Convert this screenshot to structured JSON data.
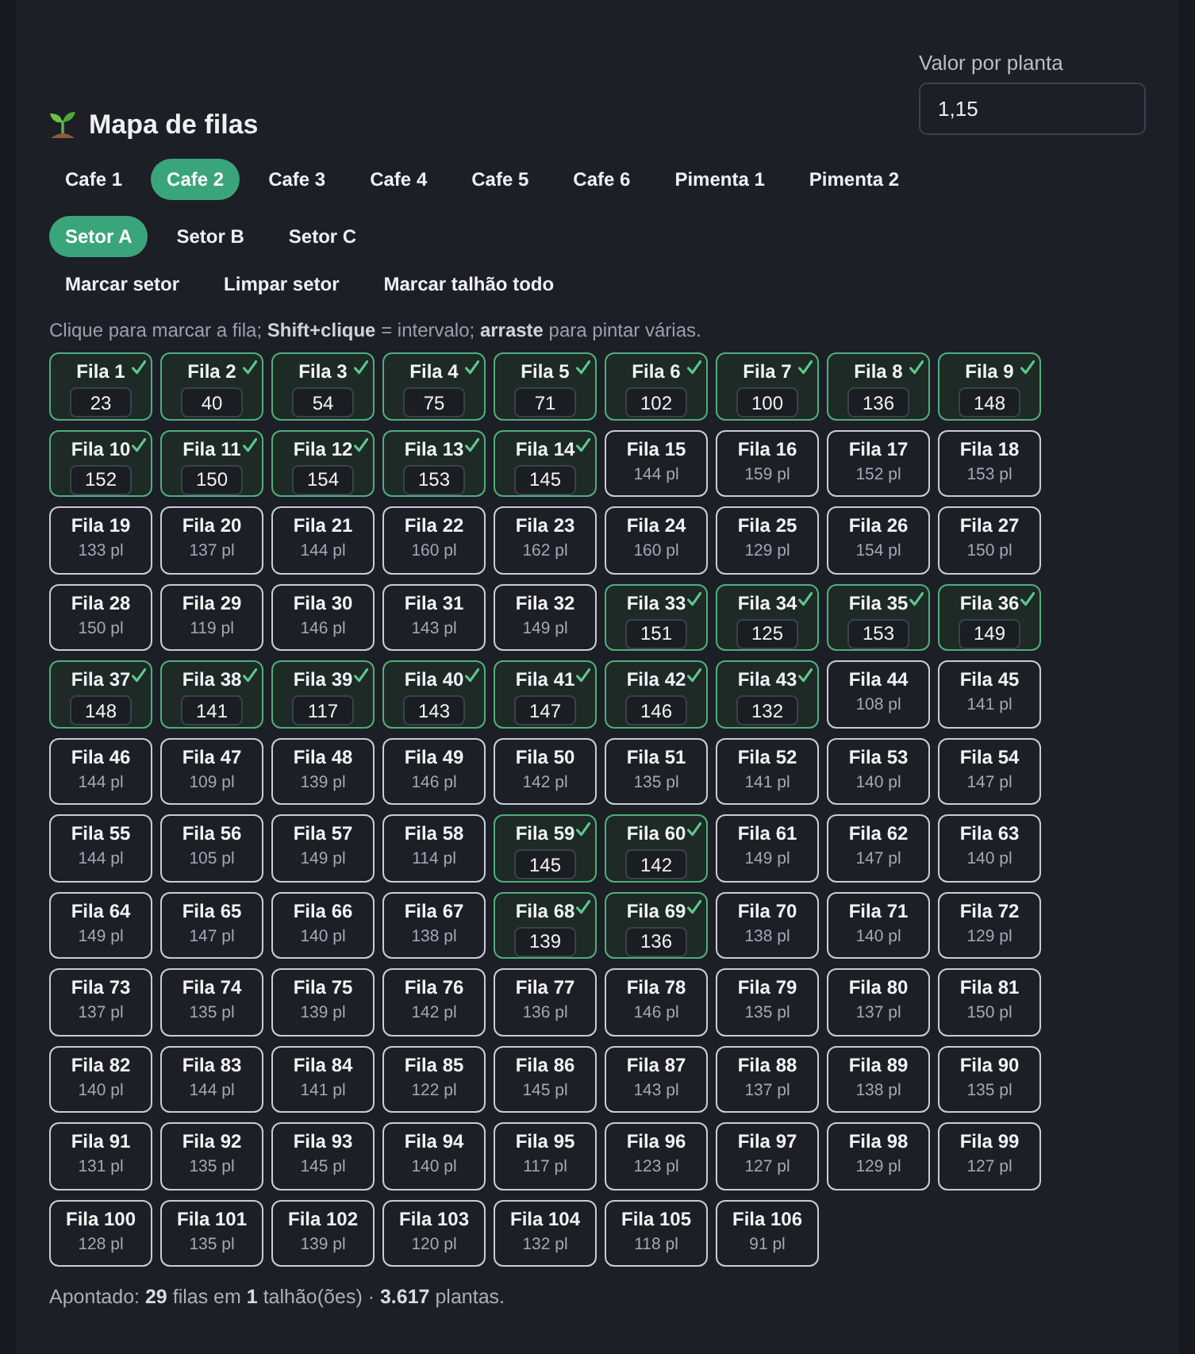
{
  "header": {
    "title": "Mapa de filas",
    "value_field": {
      "label": "Valor por planta",
      "value": "1,15"
    }
  },
  "plot_tabs": [
    {
      "label": "Cafe 1",
      "selected": false
    },
    {
      "label": "Cafe 2",
      "selected": true
    },
    {
      "label": "Cafe 3",
      "selected": false
    },
    {
      "label": "Cafe 4",
      "selected": false
    },
    {
      "label": "Cafe 5",
      "selected": false
    },
    {
      "label": "Cafe 6",
      "selected": false
    },
    {
      "label": "Pimenta 1",
      "selected": false
    },
    {
      "label": "Pimenta 2",
      "selected": false
    }
  ],
  "sector_tabs": [
    {
      "label": "Setor A",
      "selected": true
    },
    {
      "label": "Setor B",
      "selected": false
    },
    {
      "label": "Setor C",
      "selected": false
    }
  ],
  "actions": [
    "Marcar setor",
    "Limpar setor",
    "Marcar talhão todo"
  ],
  "hint": "Clique para marcar a fila; **Shift+clique** = intervalo; **arraste** para pintar várias.",
  "rows": [
    {
      "label": "Fila 1",
      "checked": true,
      "value": "23"
    },
    {
      "label": "Fila 2",
      "checked": true,
      "value": "40"
    },
    {
      "label": "Fila 3",
      "checked": true,
      "value": "54"
    },
    {
      "label": "Fila 4",
      "checked": true,
      "value": "75"
    },
    {
      "label": "Fila 5",
      "checked": true,
      "value": "71"
    },
    {
      "label": "Fila 6",
      "checked": true,
      "value": "102"
    },
    {
      "label": "Fila 7",
      "checked": true,
      "value": "100"
    },
    {
      "label": "Fila 8",
      "checked": true,
      "value": "136"
    },
    {
      "label": "Fila 9",
      "checked": true,
      "value": "148"
    },
    {
      "label": "Fila 10",
      "checked": true,
      "value": "152"
    },
    {
      "label": "Fila 11",
      "checked": true,
      "value": "150"
    },
    {
      "label": "Fila 12",
      "checked": true,
      "value": "154"
    },
    {
      "label": "Fila 13",
      "checked": true,
      "value": "153"
    },
    {
      "label": "Fila 14",
      "checked": true,
      "value": "145"
    },
    {
      "label": "Fila 15",
      "checked": false,
      "plants": "144 pl"
    },
    {
      "label": "Fila 16",
      "checked": false,
      "plants": "159 pl"
    },
    {
      "label": "Fila 17",
      "checked": false,
      "plants": "152 pl"
    },
    {
      "label": "Fila 18",
      "checked": false,
      "plants": "153 pl"
    },
    {
      "label": "Fila 19",
      "checked": false,
      "plants": "133 pl"
    },
    {
      "label": "Fila 20",
      "checked": false,
      "plants": "137 pl"
    },
    {
      "label": "Fila 21",
      "checked": false,
      "plants": "144 pl"
    },
    {
      "label": "Fila 22",
      "checked": false,
      "plants": "160 pl"
    },
    {
      "label": "Fila 23",
      "checked": false,
      "plants": "162 pl"
    },
    {
      "label": "Fila 24",
      "checked": false,
      "plants": "160 pl"
    },
    {
      "label": "Fila 25",
      "checked": false,
      "plants": "129 pl"
    },
    {
      "label": "Fila 26",
      "checked": false,
      "plants": "154 pl"
    },
    {
      "label": "Fila 27",
      "checked": false,
      "plants": "150 pl"
    },
    {
      "label": "Fila 28",
      "checked": false,
      "plants": "150 pl"
    },
    {
      "label": "Fila 29",
      "checked": false,
      "plants": "119 pl"
    },
    {
      "label": "Fila 30",
      "checked": false,
      "plants": "146 pl"
    },
    {
      "label": "Fila 31",
      "checked": false,
      "plants": "143 pl"
    },
    {
      "label": "Fila 32",
      "checked": false,
      "plants": "149 pl"
    },
    {
      "label": "Fila 33",
      "checked": true,
      "value": "151"
    },
    {
      "label": "Fila 34",
      "checked": true,
      "value": "125"
    },
    {
      "label": "Fila 35",
      "checked": true,
      "value": "153"
    },
    {
      "label": "Fila 36",
      "checked": true,
      "value": "149"
    },
    {
      "label": "Fila 37",
      "checked": true,
      "value": "148"
    },
    {
      "label": "Fila 38",
      "checked": true,
      "value": "141"
    },
    {
      "label": "Fila 39",
      "checked": true,
      "value": "117"
    },
    {
      "label": "Fila 40",
      "checked": true,
      "value": "143"
    },
    {
      "label": "Fila 41",
      "checked": true,
      "value": "147"
    },
    {
      "label": "Fila 42",
      "checked": true,
      "value": "146"
    },
    {
      "label": "Fila 43",
      "checked": true,
      "value": "132"
    },
    {
      "label": "Fila 44",
      "checked": false,
      "plants": "108 pl"
    },
    {
      "label": "Fila 45",
      "checked": false,
      "plants": "141 pl"
    },
    {
      "label": "Fila 46",
      "checked": false,
      "plants": "144 pl"
    },
    {
      "label": "Fila 47",
      "checked": false,
      "plants": "109 pl"
    },
    {
      "label": "Fila 48",
      "checked": false,
      "plants": "139 pl"
    },
    {
      "label": "Fila 49",
      "checked": false,
      "plants": "146 pl"
    },
    {
      "label": "Fila 50",
      "checked": false,
      "plants": "142 pl"
    },
    {
      "label": "Fila 51",
      "checked": false,
      "plants": "135 pl"
    },
    {
      "label": "Fila 52",
      "checked": false,
      "plants": "141 pl"
    },
    {
      "label": "Fila 53",
      "checked": false,
      "plants": "140 pl"
    },
    {
      "label": "Fila 54",
      "checked": false,
      "plants": "147 pl"
    },
    {
      "label": "Fila 55",
      "checked": false,
      "plants": "144 pl"
    },
    {
      "label": "Fila 56",
      "checked": false,
      "plants": "105 pl"
    },
    {
      "label": "Fila 57",
      "checked": false,
      "plants": "149 pl"
    },
    {
      "label": "Fila 58",
      "checked": false,
      "plants": "114 pl"
    },
    {
      "label": "Fila 59",
      "checked": true,
      "value": "145"
    },
    {
      "label": "Fila 60",
      "checked": true,
      "value": "142"
    },
    {
      "label": "Fila 61",
      "checked": false,
      "plants": "149 pl"
    },
    {
      "label": "Fila 62",
      "checked": false,
      "plants": "147 pl"
    },
    {
      "label": "Fila 63",
      "checked": false,
      "plants": "140 pl"
    },
    {
      "label": "Fila 64",
      "checked": false,
      "plants": "149 pl"
    },
    {
      "label": "Fila 65",
      "checked": false,
      "plants": "147 pl"
    },
    {
      "label": "Fila 66",
      "checked": false,
      "plants": "140 pl"
    },
    {
      "label": "Fila 67",
      "checked": false,
      "plants": "138 pl"
    },
    {
      "label": "Fila 68",
      "checked": true,
      "value": "139"
    },
    {
      "label": "Fila 69",
      "checked": true,
      "value": "136"
    },
    {
      "label": "Fila 70",
      "checked": false,
      "plants": "138 pl"
    },
    {
      "label": "Fila 71",
      "checked": false,
      "plants": "140 pl"
    },
    {
      "label": "Fila 72",
      "checked": false,
      "plants": "129 pl"
    },
    {
      "label": "Fila 73",
      "checked": false,
      "plants": "137 pl"
    },
    {
      "label": "Fila 74",
      "checked": false,
      "plants": "135 pl"
    },
    {
      "label": "Fila 75",
      "checked": false,
      "plants": "139 pl"
    },
    {
      "label": "Fila 76",
      "checked": false,
      "plants": "142 pl"
    },
    {
      "label": "Fila 77",
      "checked": false,
      "plants": "136 pl"
    },
    {
      "label": "Fila 78",
      "checked": false,
      "plants": "146 pl"
    },
    {
      "label": "Fila 79",
      "checked": false,
      "plants": "135 pl"
    },
    {
      "label": "Fila 80",
      "checked": false,
      "plants": "137 pl"
    },
    {
      "label": "Fila 81",
      "checked": false,
      "plants": "150 pl"
    },
    {
      "label": "Fila 82",
      "checked": false,
      "plants": "140 pl"
    },
    {
      "label": "Fila 83",
      "checked": false,
      "plants": "144 pl"
    },
    {
      "label": "Fila 84",
      "checked": false,
      "plants": "141 pl"
    },
    {
      "label": "Fila 85",
      "checked": false,
      "plants": "122 pl"
    },
    {
      "label": "Fila 86",
      "checked": false,
      "plants": "145 pl"
    },
    {
      "label": "Fila 87",
      "checked": false,
      "plants": "143 pl"
    },
    {
      "label": "Fila 88",
      "checked": false,
      "plants": "137 pl"
    },
    {
      "label": "Fila 89",
      "checked": false,
      "plants": "138 pl"
    },
    {
      "label": "Fila 90",
      "checked": false,
      "plants": "135 pl"
    },
    {
      "label": "Fila 91",
      "checked": false,
      "plants": "131 pl"
    },
    {
      "label": "Fila 92",
      "checked": false,
      "plants": "135 pl"
    },
    {
      "label": "Fila 93",
      "checked": false,
      "plants": "145 pl"
    },
    {
      "label": "Fila 94",
      "checked": false,
      "plants": "140 pl"
    },
    {
      "label": "Fila 95",
      "checked": false,
      "plants": "117 pl"
    },
    {
      "label": "Fila 96",
      "checked": false,
      "plants": "123 pl"
    },
    {
      "label": "Fila 97",
      "checked": false,
      "plants": "127 pl"
    },
    {
      "label": "Fila 98",
      "checked": false,
      "plants": "129 pl"
    },
    {
      "label": "Fila 99",
      "checked": false,
      "plants": "127 pl"
    },
    {
      "label": "Fila 100",
      "checked": false,
      "plants": "128 pl"
    },
    {
      "label": "Fila 101",
      "checked": false,
      "plants": "135 pl"
    },
    {
      "label": "Fila 102",
      "checked": false,
      "plants": "139 pl"
    },
    {
      "label": "Fila 103",
      "checked": false,
      "plants": "120 pl"
    },
    {
      "label": "Fila 104",
      "checked": false,
      "plants": "132 pl"
    },
    {
      "label": "Fila 105",
      "checked": false,
      "plants": "118 pl"
    },
    {
      "label": "Fila 106",
      "checked": false,
      "plants": "91 pl"
    }
  ],
  "summary": "Apontado: **29** filas em **1** talhão(ões) · **3.617** plantas."
}
